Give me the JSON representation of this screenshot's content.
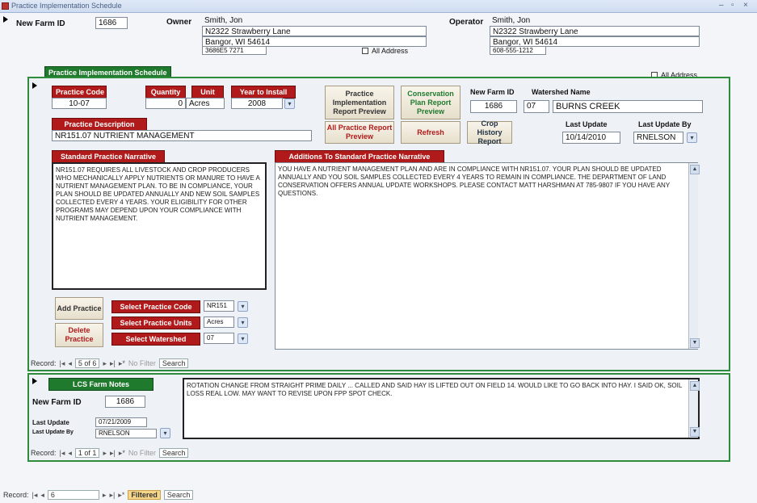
{
  "window": {
    "title": "Practice Implementation Schedule",
    "min": "–",
    "max": "▫",
    "close": "×"
  },
  "header": {
    "new_farm_id_label": "New Farm ID",
    "new_farm_id": "1686",
    "owner_label": "Owner",
    "owner_name": "Smith, Jon",
    "owner_addr1": "N2322 Strawberry Lane",
    "owner_addr2": "Bangor, WI 54614",
    "owner_phone": "3686E5 7271",
    "all_address_label": "All Address",
    "operator_label": "Operator",
    "operator_name": "Smith, Jon",
    "operator_addr1": "N2322 Strawberry Lane",
    "operator_addr2": "Bangor, WI 54614",
    "operator_phone": "608-555-1212",
    "all_address_label2": "All Address",
    "schedule_tab": "Practice Implementation Schedule"
  },
  "practice": {
    "code_label": "Practice Code",
    "code": "10-07",
    "quantity_label": "Quantity",
    "quantity": "0",
    "unit_label": "Unit",
    "unit": "Acres",
    "year_label": "Year to Install",
    "year": "2008",
    "desc_label": "Practice Description",
    "desc": "NR151.07 NUTRIENT MANAGEMENT",
    "narrative_label": "Standard Practice Narrative",
    "narrative": "NR151.07 REQUIRES ALL LIVESTOCK AND CROP PRODUCERS WHO MECHANICALLY APPLY NUTRIENTS OR MANURE TO HAVE A NUTRIENT MANAGEMENT PLAN. TO BE IN COMPLIANCE, YOUR PLAN SHOULD BE UPDATED ANNUALLY AND NEW SOIL SAMPLES COLLECTED EVERY 4 YEARS. YOUR ELIGIBILITY FOR OTHER PROGRAMS MAY DEPEND UPON YOUR COMPLIANCE WITH NUTRIENT MANAGEMENT.",
    "additions_label": "Additions To Standard Practice Narrative",
    "additions": "YOU HAVE A NUTRIENT MANAGEMENT PLAN AND ARE IN COMPLIANCE WITH NR151.07. YOUR PLAN SHOULD BE UPDATED ANNUALLY AND YOU SOIL SAMPLES COLLECTED EVERY 4 YEARS TO REMAIN IN COMPLIANCE. THE DEPARTMENT OF LAND CONSERVATION OFFERS ANNUAL UPDATE WORKSHOPS. PLEASE CONTACT MATT HARSHMAN AT 785-9807 IF YOU HAVE ANY QUESTIONS."
  },
  "buttons": {
    "pip_preview": "Practice Implementation Report Preview",
    "cons_preview": "Conservation Plan Report Preview",
    "all_practice": "All Practice Report Preview",
    "refresh": "Refresh",
    "crop_history": "Crop History Report",
    "add_practice": "Add Practice",
    "delete_practice": "Delete Practice",
    "select_code": "Select Practice Code",
    "select_units": "Select Practice Units",
    "select_watershed": "Select Watershed",
    "select_code_val": "NR151",
    "select_units_val": "Acres",
    "select_watershed_val": "07"
  },
  "farm_info": {
    "new_farm_id_label": "New Farm ID",
    "new_farm_id": "1686",
    "watershed_label": "Watershed Name",
    "watershed_code": "07",
    "watershed_name": "BURNS CREEK",
    "last_update_label": "Last Update",
    "last_update": "10/14/2010",
    "last_update_by_label": "Last Update By",
    "last_update_by": "RNELSON"
  },
  "nav1": {
    "record_label": "Record:",
    "pos": "5 of 6",
    "filter": "No Filter",
    "search": "Search"
  },
  "lcs": {
    "title": "LCS Farm Notes",
    "farm_id_label": "New Farm ID",
    "farm_id": "1686",
    "last_update_label": "Last Update",
    "last_update": "07/21/2009",
    "last_update_by_label": "Last Update By",
    "last_update_by": "RNELSON",
    "notes": "ROTATION CHANGE FROM STRAIGHT PRIME DAILY ... CALLED AND SAID HAY IS LIFTED OUT ON FIELD 14. WOULD LIKE TO GO BACK INTO HAY. I SAID OK, SOIL LOSS REAL LOW. MAY WANT TO REVISE UPON FPP SPOT CHECK."
  },
  "nav2": {
    "record_label": "Record:",
    "pos": "1 of 1",
    "filter": "No Filter",
    "search": "Search"
  },
  "nav3": {
    "record_label": "Record:",
    "pos": "6",
    "filter": "Filtered",
    "search": "Search"
  }
}
